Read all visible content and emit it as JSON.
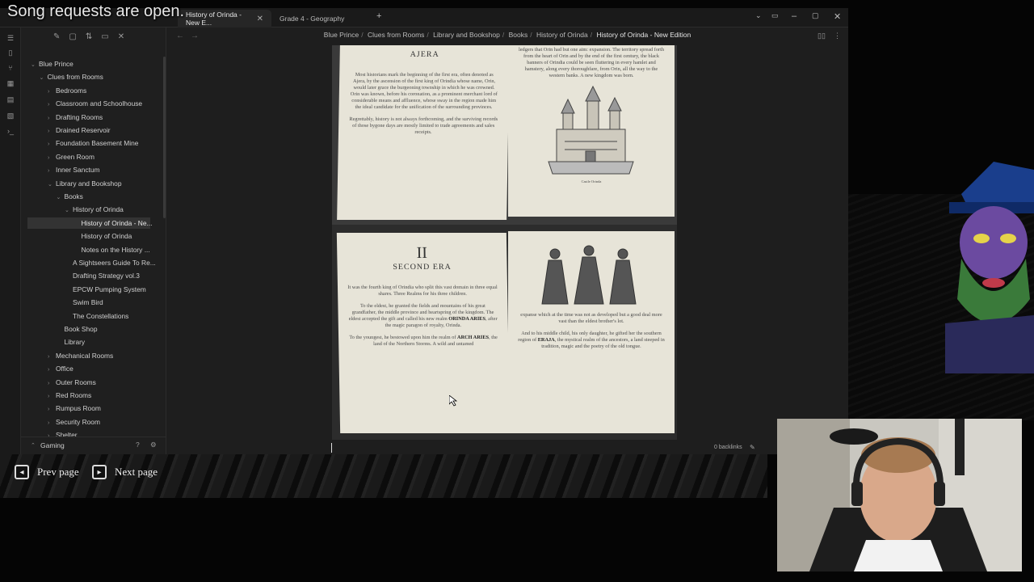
{
  "overlay": {
    "song_text": "Song requests are open."
  },
  "tabs": [
    {
      "label": "History of Orinda - New E...",
      "active": true
    },
    {
      "label": "Grade 4 - Geography",
      "active": false
    }
  ],
  "breadcrumb": [
    "Blue Prince",
    "Clues from Rooms",
    "Library and Bookshop",
    "Books",
    "History of Orinda",
    "History of Orinda - New Edition"
  ],
  "sidebar": {
    "items": [
      {
        "label": "Blue Prince",
        "depth": 0,
        "open": true
      },
      {
        "label": "Clues from Rooms",
        "depth": 1,
        "open": true
      },
      {
        "label": "Bedrooms",
        "depth": 2
      },
      {
        "label": "Classroom and Schoolhouse",
        "depth": 2
      },
      {
        "label": "Drafting Rooms",
        "depth": 2
      },
      {
        "label": "Drained Reservoir",
        "depth": 2
      },
      {
        "label": "Foundation Basement Mine",
        "depth": 2
      },
      {
        "label": "Green Room",
        "depth": 2
      },
      {
        "label": "Inner Sanctum",
        "depth": 2
      },
      {
        "label": "Library and Bookshop",
        "depth": 2,
        "open": true
      },
      {
        "label": "Books",
        "depth": 3,
        "open": true
      },
      {
        "label": "History of Orinda",
        "depth": 4,
        "open": true
      },
      {
        "label": "History of Orinda - Ne...",
        "depth": 5,
        "leaf": true,
        "selected": true
      },
      {
        "label": "History of Orinda",
        "depth": 5,
        "leaf": true
      },
      {
        "label": "Notes on the History ...",
        "depth": 5,
        "leaf": true
      },
      {
        "label": "A Sightseers Guide To Re...",
        "depth": 4,
        "leaf": true
      },
      {
        "label": "Drafting Strategy vol.3",
        "depth": 4,
        "leaf": true
      },
      {
        "label": "EPCW Pumping System",
        "depth": 4,
        "leaf": true
      },
      {
        "label": "Swim Bird",
        "depth": 4,
        "leaf": true
      },
      {
        "label": "The Constellations",
        "depth": 4,
        "leaf": true
      },
      {
        "label": "Book Shop",
        "depth": 3,
        "leaf": true
      },
      {
        "label": "Library",
        "depth": 3,
        "leaf": true
      },
      {
        "label": "Mechanical Rooms",
        "depth": 2
      },
      {
        "label": "Office",
        "depth": 2
      },
      {
        "label": "Outer Rooms",
        "depth": 2
      },
      {
        "label": "Red Rooms",
        "depth": 2
      },
      {
        "label": "Rumpus Room",
        "depth": 2
      },
      {
        "label": "Security Room",
        "depth": 2
      },
      {
        "label": "Shelter",
        "depth": 2
      }
    ],
    "footer_vault": "Gaming"
  },
  "book": {
    "page1": {
      "heading": "AJERA",
      "para1": "Most historians mark the beginning of the first era, often denoted as Ajera, by the ascension of the first king of Orindia whose name, Orin, would later grace the burgeoning township in which he was crowned. Orin was known, before his coronation, as a prominent merchant lord of considerable means and affluence, whose sway in the region made him the ideal candidate for the unification of the surrounding provinces.",
      "para2": "Regrettably, history is not always forthcoming, and the surviving records of those bygone days are mostly limited to trade agreements and sales receipts."
    },
    "page2": {
      "para1": "ledgers that Orin had but one aim: expansion. The territory spread forth from the heart of Orin and by the end of the first century, the black banners of Orindia could be seen fluttering in every hamlet and hamstery, along every thoroughfare, from Orin, all the way to the western banks. A new kingdom was born.",
      "caption": "Castle Orinda"
    },
    "page3": {
      "numeral": "II",
      "heading": "SECOND ERA",
      "para1": "It was the fourth king of Orindia who split this vast domain in three equal shares. Three Realms for his three children.",
      "para2_pre": "To the eldest, he granted the fields and mountains of his great grandfather, the middle province and heartspring of the kingdom. The eldest accepted the gift and called his new realm",
      "para2_name": "ORINDA ARIES",
      "para2_post": ", after the magic paragon of royalty, Orinda.",
      "para3_pre": "To the youngest, he bestowed upon him the realm of",
      "para3_name": "ARCH ARIES",
      "para3_post": ", the land of the Northern Storms. A wild and untamed"
    },
    "page4": {
      "para1": "expanse which at the time was not as developed but a good deal more vast than the eldest brother's lot.",
      "para2_pre": "And to his middle child, his only daughter, he gifted her the southern region of",
      "para2_name": "ERAJA",
      "para2_post": ", the mystical realm of the ancestors, a land steeped in tradition, magic and the poetry of the old tongue."
    }
  },
  "status": {
    "backlinks": "0 backlinks"
  },
  "game_controls": {
    "prev": "Prev page",
    "next": "Next page"
  },
  "colors": {
    "app_bg": "#1e1e1e",
    "sidebar_bg": "#1f1f1f",
    "page_paper": "#e7e4d8"
  }
}
